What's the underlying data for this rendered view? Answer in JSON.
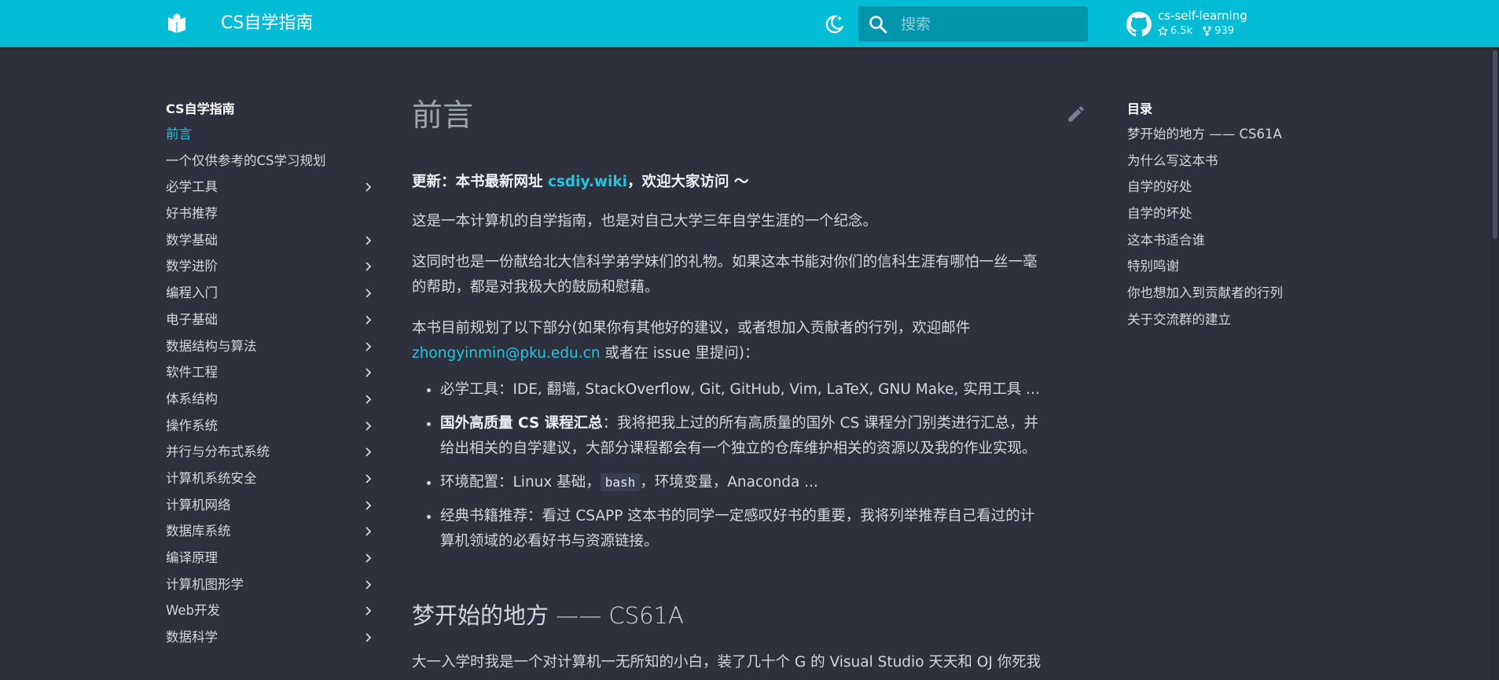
{
  "header": {
    "site_title": "CS自学指南",
    "search_placeholder": "搜索",
    "repo_name": "cs-self-learning",
    "stars": "6.5k",
    "forks": "939"
  },
  "nav": {
    "title": "CS自学指南",
    "items": [
      {
        "label": "前言",
        "active": true,
        "expandable": false
      },
      {
        "label": "一个仅供参考的CS学习规划",
        "expandable": false
      },
      {
        "label": "必学工具",
        "expandable": true
      },
      {
        "label": "好书推荐",
        "expandable": false
      },
      {
        "label": "数学基础",
        "expandable": true
      },
      {
        "label": "数学进阶",
        "expandable": true
      },
      {
        "label": "编程入门",
        "expandable": true
      },
      {
        "label": "电子基础",
        "expandable": true
      },
      {
        "label": "数据结构与算法",
        "expandable": true
      },
      {
        "label": "软件工程",
        "expandable": true
      },
      {
        "label": "体系结构",
        "expandable": true
      },
      {
        "label": "操作系统",
        "expandable": true
      },
      {
        "label": "并行与分布式系统",
        "expandable": true
      },
      {
        "label": "计算机系统安全",
        "expandable": true
      },
      {
        "label": "计算机网络",
        "expandable": true
      },
      {
        "label": "数据库系统",
        "expandable": true
      },
      {
        "label": "编译原理",
        "expandable": true
      },
      {
        "label": "计算机图形学",
        "expandable": true
      },
      {
        "label": "Web开发",
        "expandable": true
      },
      {
        "label": "数据科学",
        "expandable": true
      }
    ]
  },
  "content": {
    "title": "前言",
    "update_prefix": "更新：本书最新网址 ",
    "update_link": "csdiy.wiki",
    "update_suffix": "，欢迎大家访问 ～",
    "para1": "这是一本计算机的自学指南，也是对自己大学三年自学生涯的一个纪念。",
    "para2_line1": "这同时也是一份献给北大信科学弟学妹们的礼物。如果这本书能对你们的信科生涯有哪怕一丝一毫",
    "para2_line2": "的帮助，都是对我极大的鼓励和慰藉。",
    "para3_line1": "本书目前规划了以下部分(如果你有其他好的建议，或者想加入贡献者的行列，欢迎邮件",
    "para3_email": "zhongyinmin@pku.edu.cn",
    "para3_suffix": " 或者在 issue 里提问)：",
    "bullet1": "必学工具：IDE, 翻墙, StackOverflow, Git, GitHub, Vim, LaTeX, GNU Make, 实用工具 ...",
    "bullet2_bold": "国外高质量 CS 课程汇总",
    "bullet2_line1": "：我将把我上过的所有高质量的国外 CS 课程分门别类进行汇总，并",
    "bullet2_line2": "给出相关的自学建议，大部分课程都会有一个独立的仓库维护相关的资源以及我的作业实现。",
    "bullet3_prefix": "环境配置：Linux 基础，",
    "bullet3_code": "bash",
    "bullet3_suffix": "，环境变量，Anaconda ...",
    "bullet4_line1": "经典书籍推荐：看过 CSAPP 这本书的同学一定感叹好书的重要，我将列举推荐自己看过的计",
    "bullet4_line2": "算机领域的必看好书与资源链接。",
    "section_heading": "梦开始的地方 —— CS61A",
    "para5": "大一入学时我是一个对计算机一无所知的小白，装了几十个 G 的 Visual Studio 天天和 OJ 你死我"
  },
  "toc": {
    "title": "目录",
    "items": [
      "梦开始的地方 —— CS61A",
      "为什么写这本书",
      "自学的好处",
      "自学的坏处",
      "这本书适合谁",
      "特别鸣谢",
      "你也想加入到贡献者的行列",
      "关于交流群的建立"
    ]
  },
  "colors": {
    "header": "#00bcd4",
    "background": "#2e303e",
    "accent": "#1fc7df"
  }
}
